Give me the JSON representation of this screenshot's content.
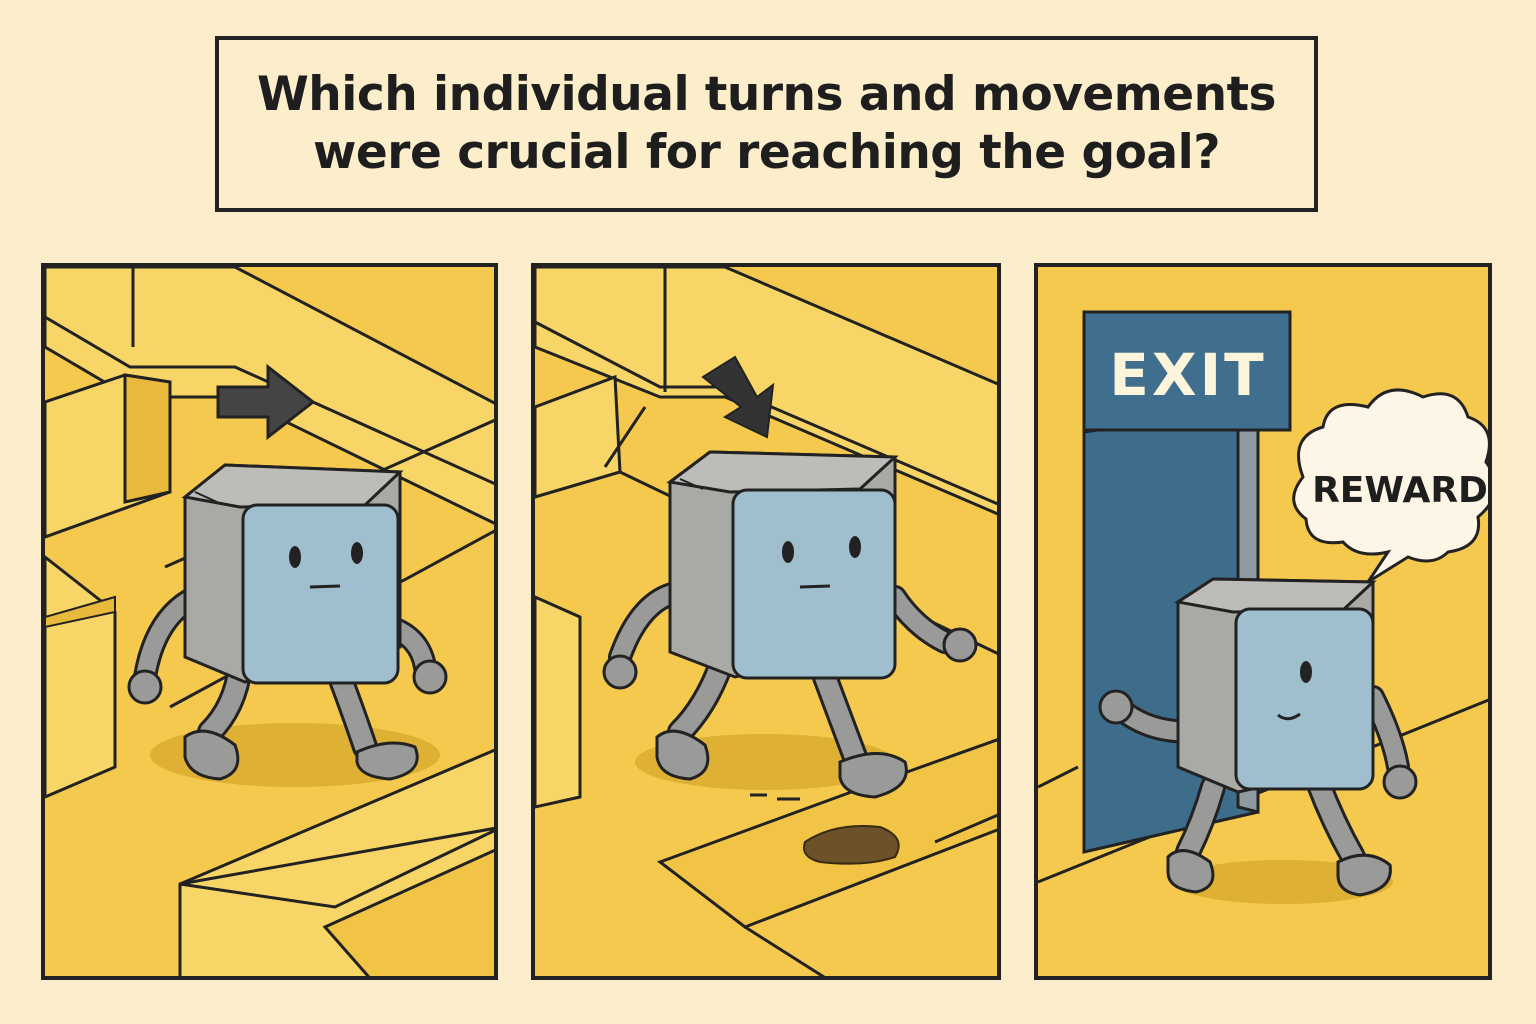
{
  "caption": {
    "line1": "Which individual turns and movements",
    "line2": "were crucial for reaching the goal?"
  },
  "panels": [
    {
      "scene": "robot walking in maze, arrow pointing right"
    },
    {
      "scene": "robot stepping in maze, arrow pointing down-right"
    },
    {
      "scene": "robot arriving at exit door with reward thought bubble"
    }
  ],
  "exit_sign": {
    "label": "EXIT"
  },
  "reward_bubble": {
    "label": "REWARD"
  },
  "colors": {
    "background": "#fbeccb",
    "maze_floor": "#f4c94e",
    "maze_wall": "#f7d363",
    "robot_body": "#a9aaa6",
    "robot_face": "#9fbfcf",
    "door": "#3e6d8c",
    "outline": "#222222"
  }
}
